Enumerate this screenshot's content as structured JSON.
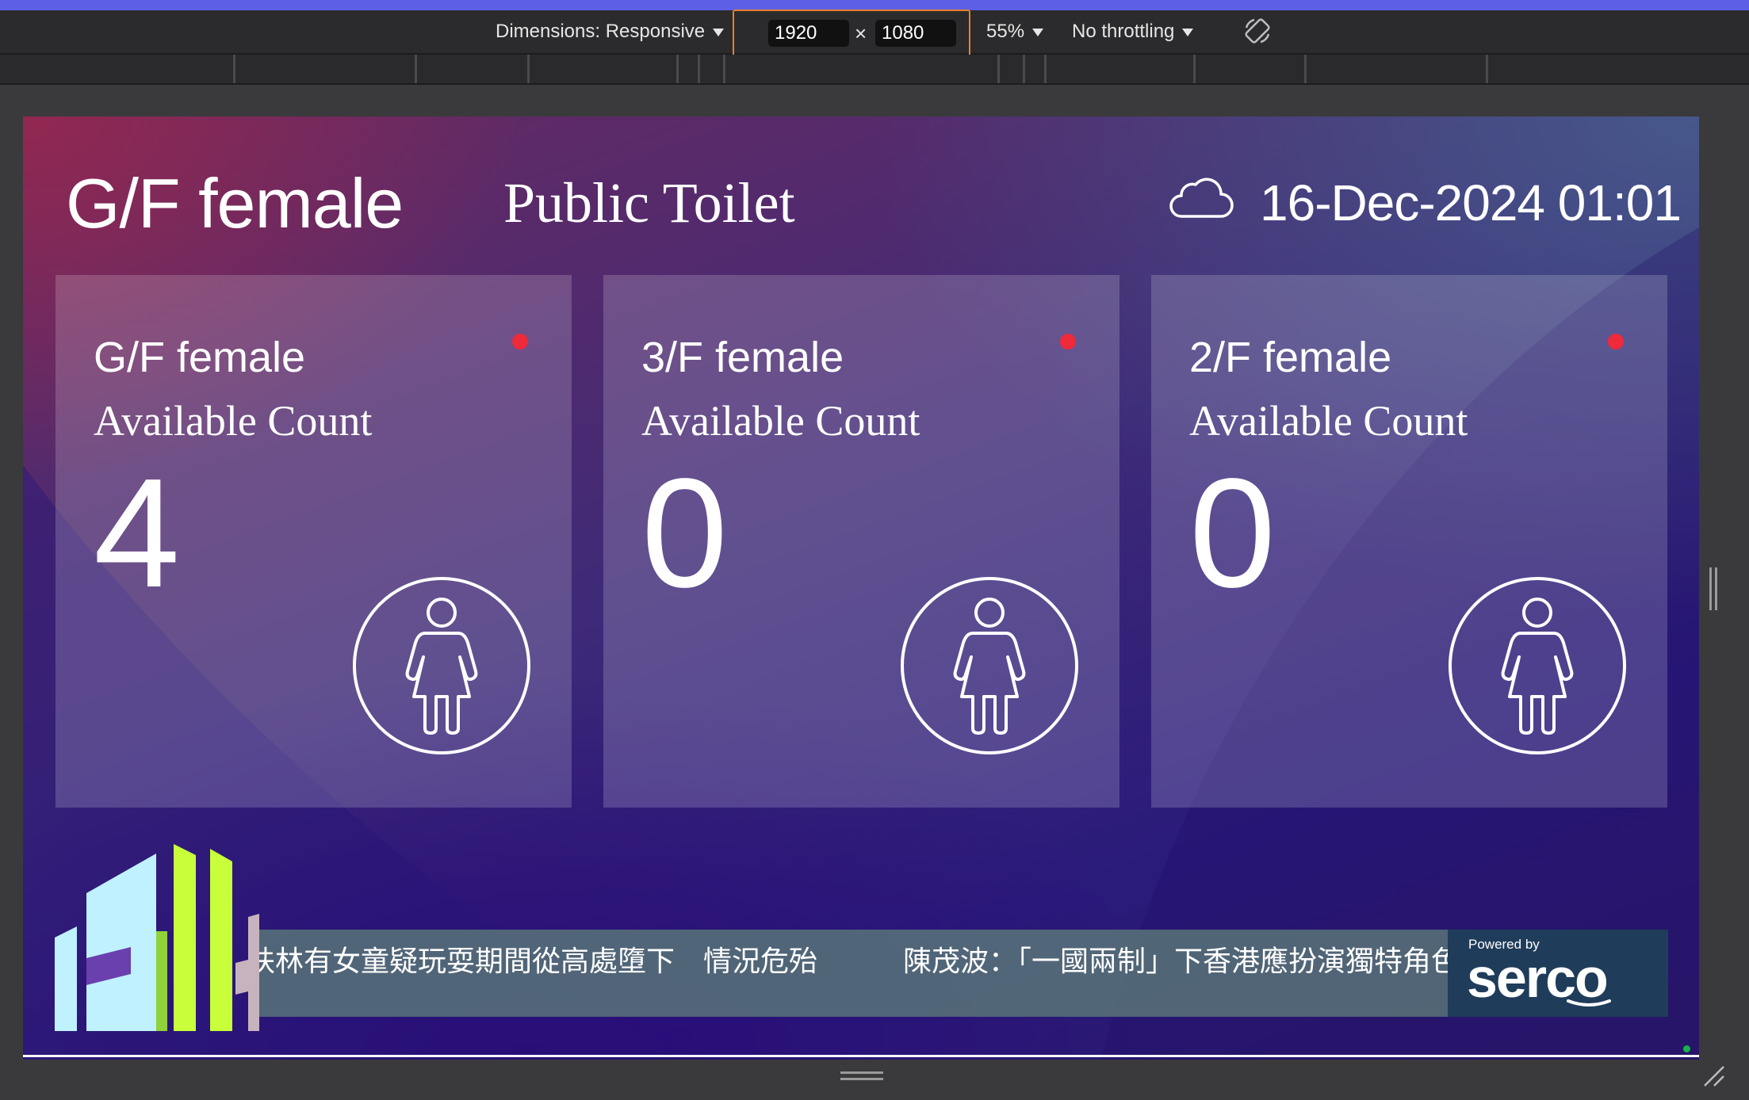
{
  "devtools": {
    "dimensions_label": "Dimensions: Responsive",
    "width_value": "1920",
    "height_value": "1080",
    "zoom_label": "55%",
    "throttling_label": "No throttling",
    "dim_separator": "×"
  },
  "kiosk": {
    "title": "G/F female",
    "subtitle": "Public Toilet",
    "weather_icon": "cloud-icon",
    "datetime": "16-Dec-2024 01:01",
    "cards": [
      {
        "floor": "G/F female",
        "label": "Available Count",
        "count": "4",
        "status_color": "#ee2a3b"
      },
      {
        "floor": "3/F female",
        "label": "Available Count",
        "count": "0",
        "status_color": "#ee2a3b"
      },
      {
        "floor": "2/F female",
        "label": "Available Count",
        "count": "0",
        "status_color": "#ee2a3b"
      }
    ],
    "ticker": "扶林有女童疑玩耍期間從高處墮下　情況危殆　　　陳茂波：「一國兩制」下香港應扮演獨特角色",
    "sponsor": {
      "prefix": "Powered by",
      "name": "serco"
    }
  }
}
